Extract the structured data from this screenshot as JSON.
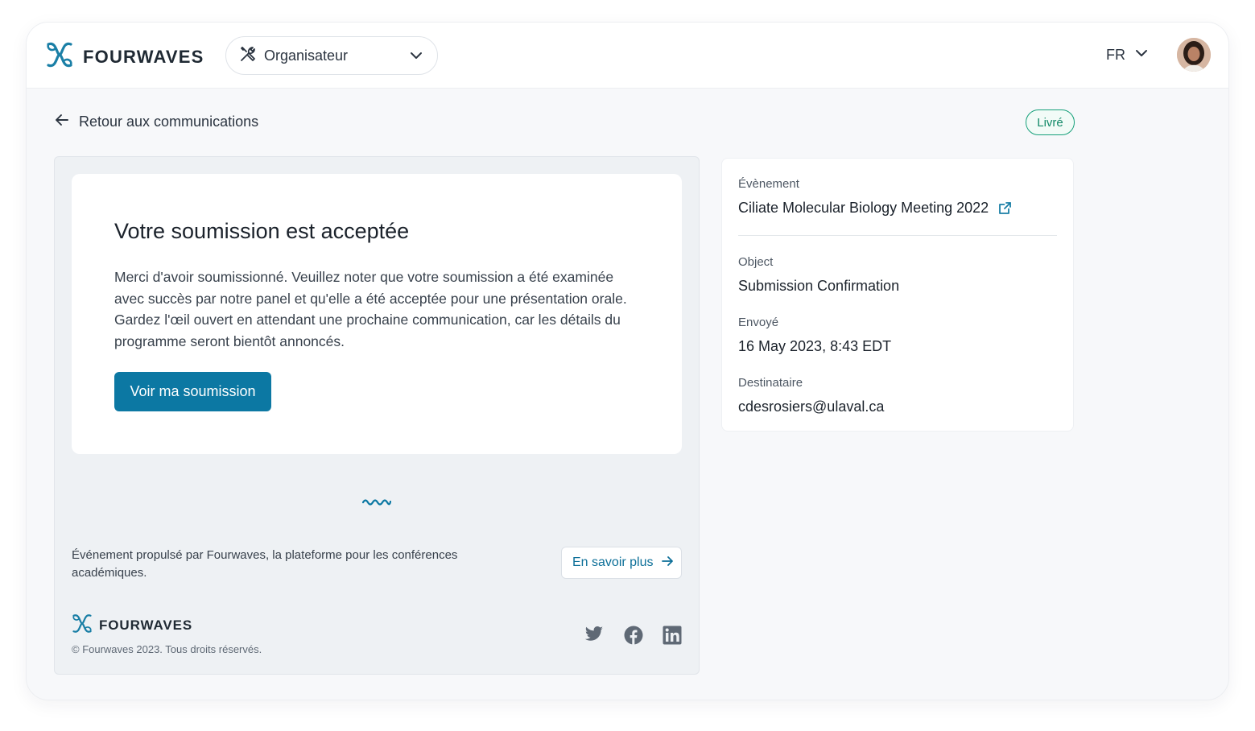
{
  "header": {
    "brand_name": "FOURWAVES",
    "role_select": {
      "value": "Organisateur"
    },
    "language": "FR",
    "brand_color": "#1a7fa6"
  },
  "back_link": {
    "label": "Retour aux communications"
  },
  "status": {
    "label": "Livré",
    "color": "#16a07a"
  },
  "email": {
    "title": "Votre soumission est acceptée",
    "body": "Merci d'avoir soumissionné. Veuillez noter que votre soumission a été examinée avec succès par notre panel et qu'elle a été acceptée pour une présentation orale. Gardez l'œil ouvert en attendant une prochaine communication, car les détails du programme seront bientôt annoncés.",
    "cta_label": "Voir ma soumission",
    "cta_color": "#0c78a3",
    "footer_text": "Événement propulsé par Fourwaves, la plateforme pour les conférences académiques.",
    "learn_more_label": "En savoir plus",
    "footer_brand": "FOURWAVES",
    "copyright": "© Fourwaves 2023. Tous droits réservés.",
    "social_icons": [
      "twitter-icon",
      "facebook-icon",
      "linkedin-icon"
    ]
  },
  "details": {
    "event_label": "Évènement",
    "event_value": "Ciliate Molecular Biology Meeting 2022",
    "object_label": "Object",
    "object_value": "Submission Confirmation",
    "sent_label": "Envoyé",
    "sent_value": "16 May 2023, 8:43 EDT",
    "recipient_label": "Destinataire",
    "recipient_value": "cdesrosiers@ulaval.ca"
  }
}
